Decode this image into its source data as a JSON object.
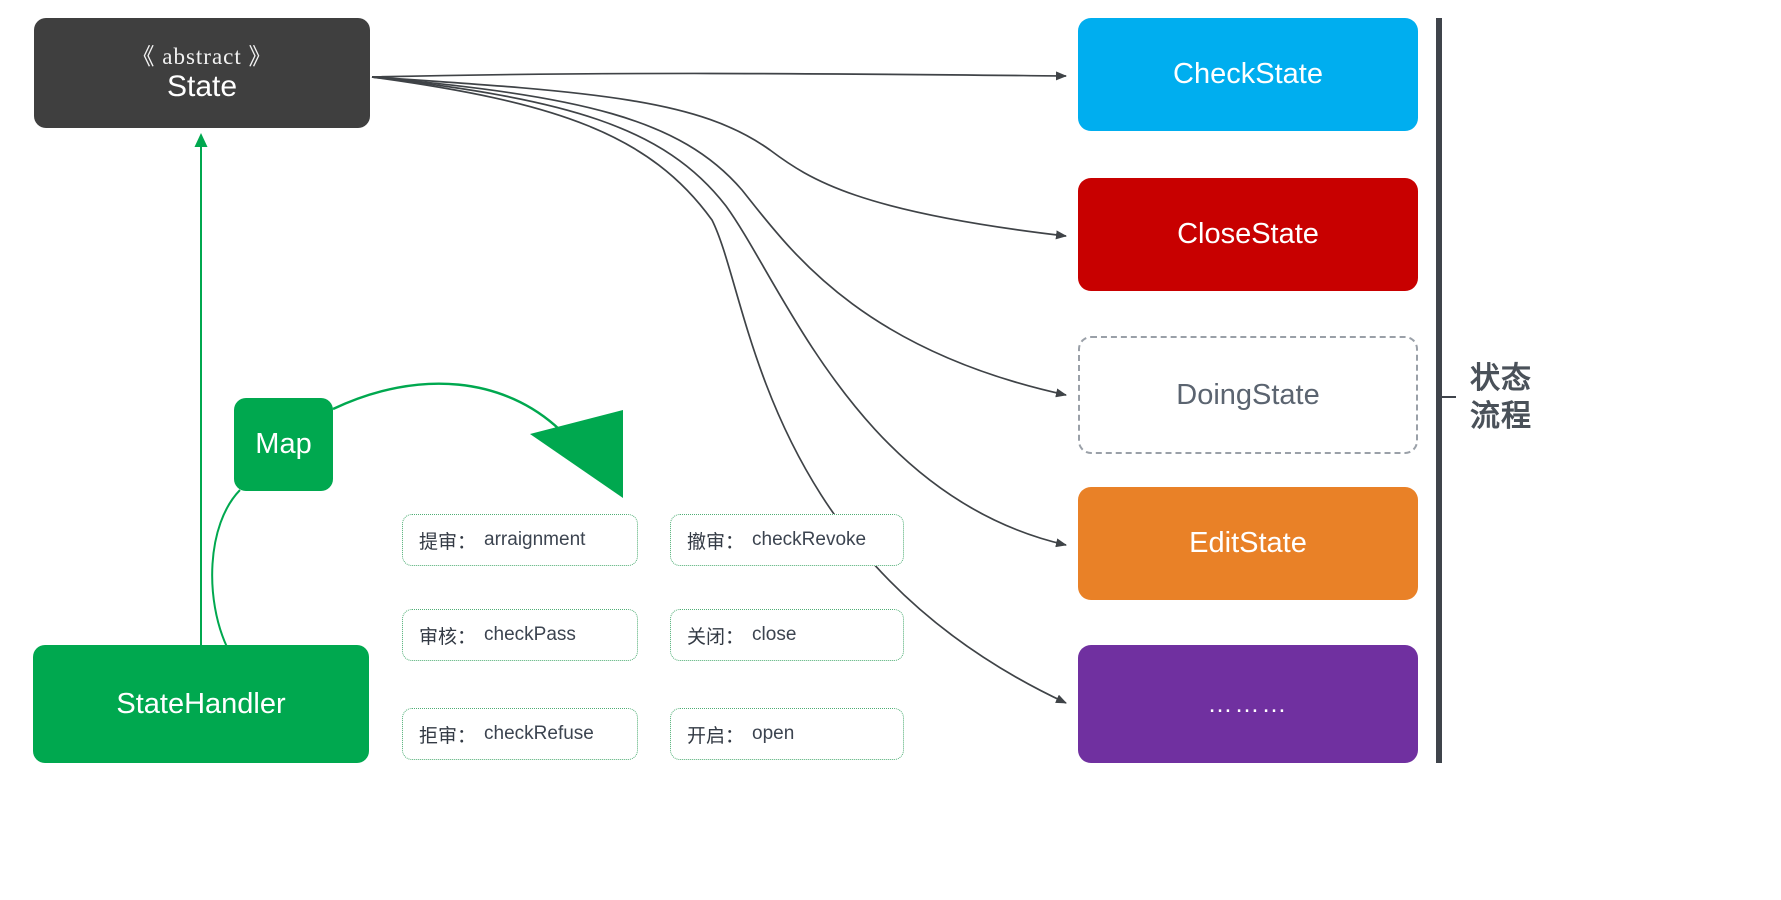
{
  "diagram": {
    "title_caption_lines": [
      "状态",
      "流程"
    ],
    "abstract_node": {
      "stereotype": "《 abstract 》",
      "name": "State",
      "fill": "#3f3f3f"
    },
    "state_nodes": [
      {
        "label": "CheckState",
        "fill": "#00AEEF",
        "style": "solid"
      },
      {
        "label": "CloseState",
        "fill": "#C80000",
        "style": "solid"
      },
      {
        "label": "DoingState",
        "fill": "#FFFFFF",
        "style": "dashed"
      },
      {
        "label": "EditState",
        "fill": "#E98127",
        "style": "solid"
      },
      {
        "label": "………",
        "fill": "#7030A0",
        "style": "solid"
      }
    ],
    "green_nodes": [
      {
        "label": "Map",
        "fill": "#00A84F"
      },
      {
        "label": "StateHandler",
        "fill": "#00A84F"
      }
    ],
    "methods": [
      {
        "cn": "提审",
        "sep": "：",
        "en": "arraignment"
      },
      {
        "cn": "审核",
        "sep": "：",
        "en": "checkPass"
      },
      {
        "cn": "拒审",
        "sep": "：",
        "en": "checkRefuse"
      },
      {
        "cn": "撤审",
        "sep": "：",
        "en": "checkRevoke"
      },
      {
        "cn": "关闭",
        "sep": "：",
        "en": "close"
      },
      {
        "cn": "开启",
        "sep": "：",
        "en": "open"
      }
    ],
    "colors": {
      "edge": "#3f4347",
      "green": "#00A84F",
      "chip_border": "#4fae75",
      "bracket": "#3f444b"
    }
  }
}
